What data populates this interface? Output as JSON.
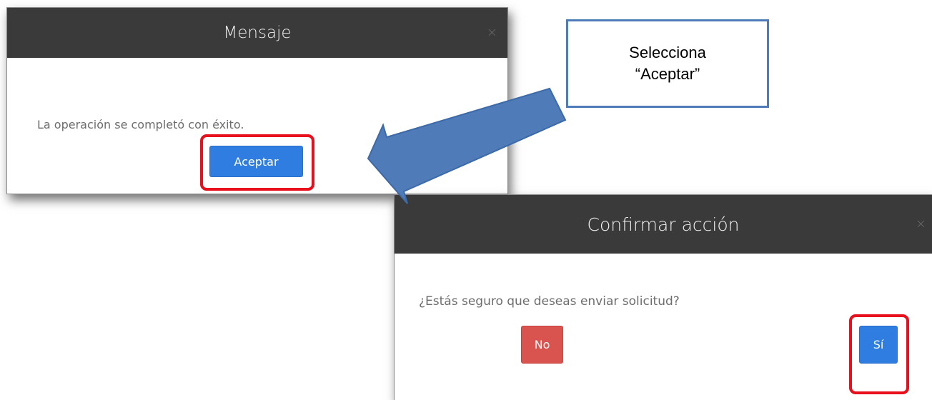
{
  "message_dialog": {
    "title": "Mensaje",
    "close_glyph": "×",
    "text": "La operación se completó con éxito.",
    "accept_label": "Aceptar"
  },
  "confirm_dialog": {
    "title": "Confirmar acción",
    "close_glyph": "×",
    "text": "¿Estás seguro que deseas enviar solicitud?",
    "no_label": "No",
    "yes_label": "Sí"
  },
  "callout": {
    "line1": "Selecciona",
    "line2": "“Aceptar”"
  },
  "colors": {
    "header_bg": "#3a3a3a",
    "primary_button": "#2f7de0",
    "danger_button": "#d9534f",
    "highlight": "#e8101c",
    "arrow_fill": "#4f7cb8"
  },
  "icons": {
    "close": "close-icon",
    "arrow": "pointer-arrow"
  }
}
